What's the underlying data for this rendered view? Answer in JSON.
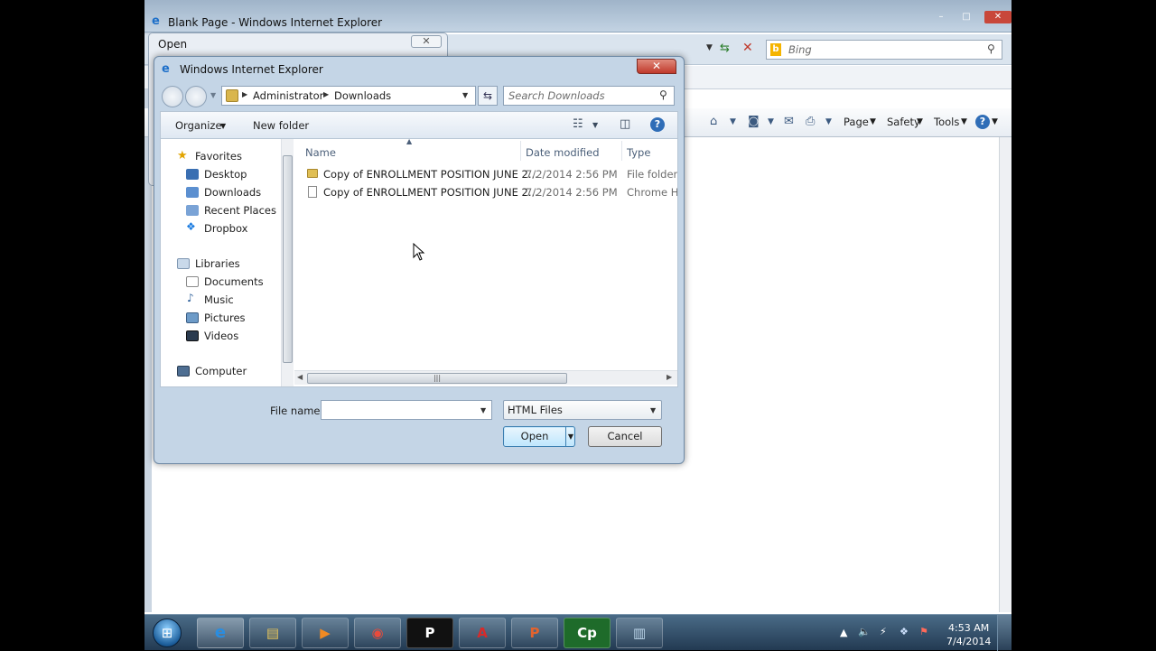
{
  "ie": {
    "title": "Blank Page - Windows Internet Explorer",
    "search_placeholder": "Bing",
    "cmd": {
      "page": "Page",
      "safety": "Safety",
      "tools": "Tools"
    }
  },
  "bg_dialog": {
    "title": "Open"
  },
  "dialog": {
    "title": "Windows Internet Explorer",
    "breadcrumb": [
      "Administrator",
      "Downloads"
    ],
    "search_placeholder": "Search Downloads",
    "toolbar": {
      "organize": "Organize",
      "new_folder": "New folder"
    },
    "nav": {
      "favorites": "Favorites",
      "fav_items": [
        "Desktop",
        "Downloads",
        "Recent Places",
        "Dropbox"
      ],
      "libraries": "Libraries",
      "lib_items": [
        "Documents",
        "Music",
        "Pictures",
        "Videos"
      ],
      "computer": "Computer"
    },
    "columns": {
      "name": "Name",
      "date": "Date modified",
      "type": "Type"
    },
    "files": [
      {
        "name": "Copy of ENROLLMENT POSITION JUNE 2...",
        "date": "7/2/2014 2:56 PM",
        "type": "File folder"
      },
      {
        "name": "Copy of ENROLLMENT POSITION JUNE 2...",
        "date": "7/2/2014 2:56 PM",
        "type": "Chrome H"
      }
    ],
    "file_name_label": "File name:",
    "file_name_value": "",
    "file_type": "HTML Files",
    "open_label": "Open",
    "cancel_label": "Cancel"
  },
  "taskbar": {
    "apps": [
      {
        "name": "internet-explorer",
        "glyph": "e"
      },
      {
        "name": "windows-explorer",
        "glyph": "▤"
      },
      {
        "name": "media-player",
        "glyph": "▶"
      },
      {
        "name": "chrome",
        "glyph": "◉"
      },
      {
        "name": "p-app",
        "glyph": "P"
      },
      {
        "name": "acrobat",
        "glyph": "A"
      },
      {
        "name": "powerpoint",
        "glyph": "P"
      },
      {
        "name": "captivate",
        "glyph": "Cp"
      },
      {
        "name": "notepad",
        "glyph": "▥"
      }
    ],
    "time": "4:53 AM",
    "date": "7/4/2014"
  }
}
